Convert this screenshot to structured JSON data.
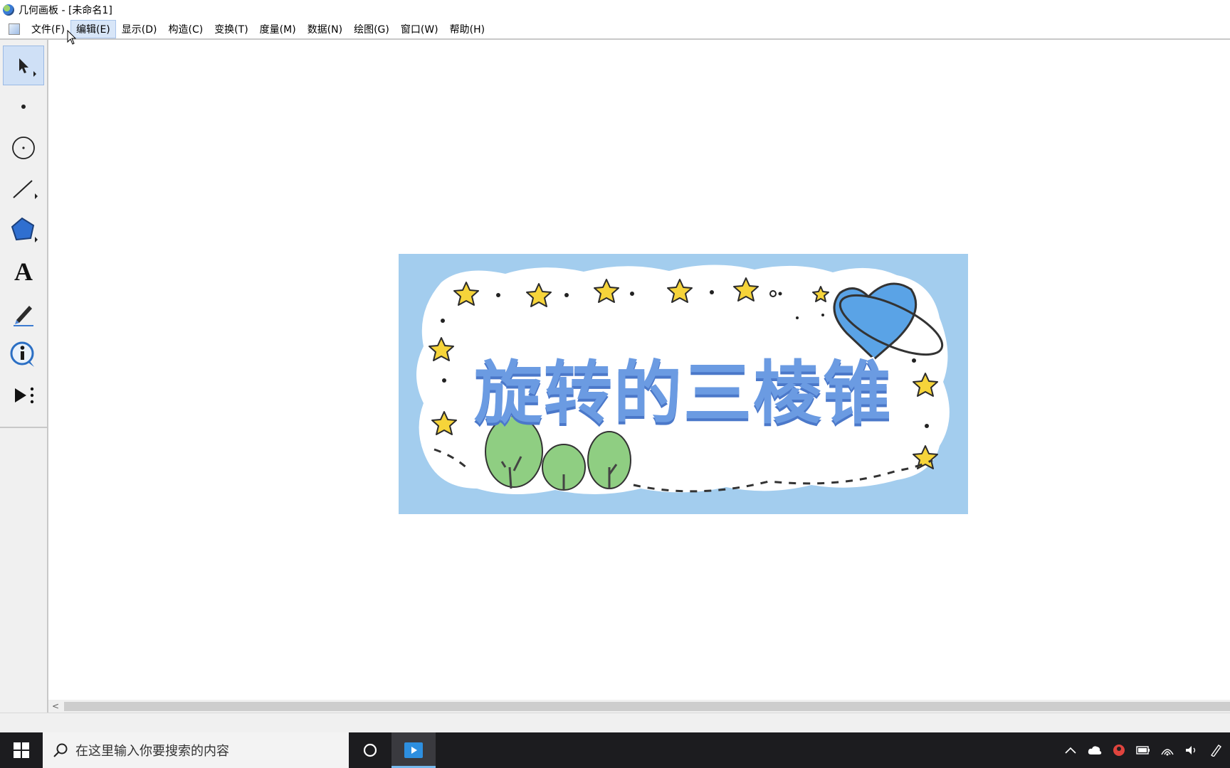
{
  "window": {
    "title": "几何画板 - [未命名1]"
  },
  "menu": {
    "items": [
      {
        "label": "文件(F)"
      },
      {
        "label": "编辑(E)",
        "active": true
      },
      {
        "label": "显示(D)"
      },
      {
        "label": "构造(C)"
      },
      {
        "label": "变换(T)"
      },
      {
        "label": "度量(M)"
      },
      {
        "label": "数据(N)"
      },
      {
        "label": "绘图(G)"
      },
      {
        "label": "窗口(W)"
      },
      {
        "label": "帮助(H)"
      }
    ]
  },
  "toolbox": {
    "tools": [
      {
        "name": "arrow-select-tool",
        "icon": "arrow-icon",
        "selected": true
      },
      {
        "name": "point-tool",
        "icon": "point-icon"
      },
      {
        "name": "compass-tool",
        "icon": "circle-icon"
      },
      {
        "name": "straightedge-tool",
        "icon": "line-segment-icon"
      },
      {
        "name": "polygon-tool",
        "icon": "polygon-icon"
      },
      {
        "name": "text-tool",
        "icon": "text-A-icon"
      },
      {
        "name": "marker-tool",
        "icon": "marker-pen-icon"
      },
      {
        "name": "information-tool",
        "icon": "info-icon"
      },
      {
        "name": "custom-tool",
        "icon": "play-menu-icon"
      }
    ]
  },
  "canvas": {
    "banner_title": "旋转的三棱锥"
  },
  "scrollbar": {
    "left_arrow": "<"
  },
  "taskbar": {
    "search_placeholder": "在这里输入你要搜索的内容",
    "tray_icons": [
      "chevron-up-icon",
      "cloud-icon",
      "app-badge-icon",
      "battery-icon",
      "wifi-icon",
      "volume-icon",
      "pen-icon"
    ]
  },
  "colors": {
    "banner_bg": "#a3cdee",
    "title_fill": "#6b9be2",
    "selected_tool": "#cfe0f6",
    "taskbar": "#1c1c1f"
  }
}
